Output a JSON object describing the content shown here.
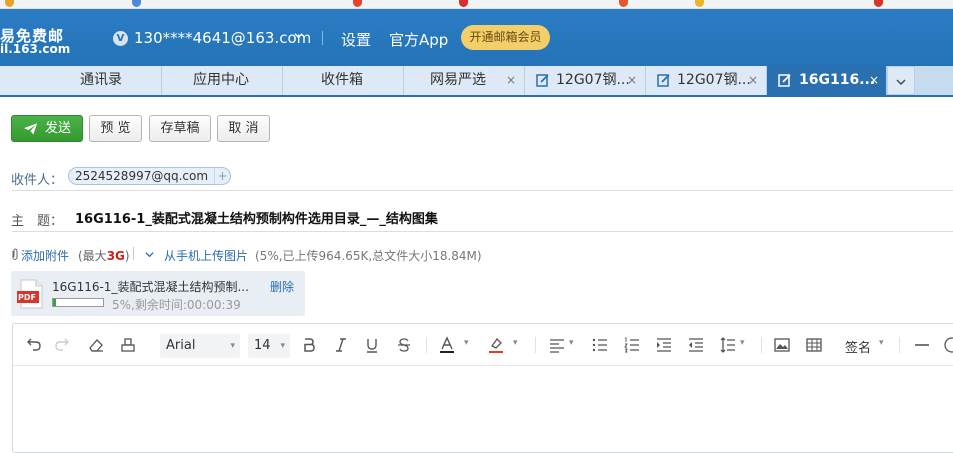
{
  "header": {
    "logo_line1": "易免费邮",
    "logo_line2": "il.163.com",
    "account": "130****4641@163.com",
    "links": [
      "设置",
      "官方App"
    ],
    "vip_button": "开通邮箱会员"
  },
  "tabs": [
    {
      "label": "通讯录",
      "closable": false,
      "doc": false,
      "active": false
    },
    {
      "label": "应用中心",
      "closable": false,
      "doc": false,
      "active": false
    },
    {
      "label": "收件箱",
      "closable": false,
      "doc": false,
      "active": false
    },
    {
      "label": "网易严选",
      "closable": true,
      "doc": false,
      "active": false
    },
    {
      "label": "12G07钢...",
      "closable": true,
      "doc": true,
      "active": false
    },
    {
      "label": "12G07钢...",
      "closable": true,
      "doc": true,
      "active": false
    },
    {
      "label": "16G116...",
      "closable": true,
      "doc": true,
      "active": true
    }
  ],
  "tab_close": "×",
  "toolbar": {
    "send": "发送",
    "preview": "预 览",
    "draft": "存草稿",
    "cancel": "取 消"
  },
  "compose": {
    "to_label": "收件人：",
    "recipient": "2524528997@qq.com",
    "recipient_add": "+",
    "subject_label": "主　题：",
    "subject": "16G116-1_装配式混凝土结构预制构件选用目录_—_结构图集"
  },
  "attach": {
    "add": "添加附件",
    "max_prefix": "(最大",
    "max_value": "3G",
    "max_suffix": ")",
    "mobile": "从手机上传图片",
    "summary": "(5%,已上传964.65K,总文件大小18.84M)"
  },
  "file": {
    "icon_label": "PDF",
    "name": "16G116-1_装配式混凝土结构预制...",
    "status": "5%,剩余时间:00:00:39",
    "progress": 0.05,
    "delete": "删除"
  },
  "editor": {
    "font": "Arial",
    "size": "14",
    "signature": "签名"
  }
}
